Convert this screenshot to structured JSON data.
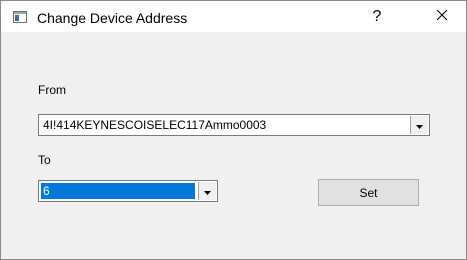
{
  "window": {
    "title": "Change Device Address",
    "help_label": "?",
    "icons": {
      "app": "window-app-icon",
      "close": "close-icon",
      "dropdown": "chevron-down-icon"
    }
  },
  "form": {
    "from_label": "From",
    "from_value": "4I!414KEYNESCOISELEC117Ammo0003",
    "to_label": "To",
    "to_value": "6",
    "set_label": "Set"
  },
  "colors": {
    "selection": "#0078d7",
    "dialog_bg": "#f0f0f0",
    "titlebar_bg": "#ffffff"
  }
}
